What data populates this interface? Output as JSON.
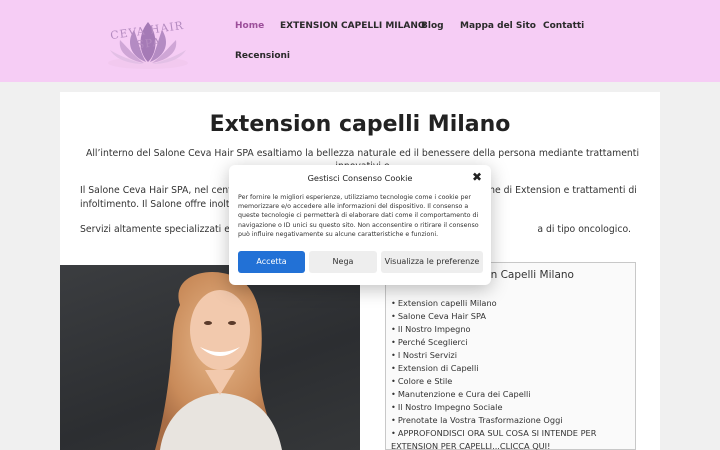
{
  "header": {
    "logo_text": "CEVA HAIR SPA",
    "nav": [
      {
        "label": "Home",
        "active": true
      },
      {
        "label": "EXTENSION CAPELLI MILANO"
      },
      {
        "label": "Blog"
      },
      {
        "label": "Mappa del Sito"
      },
      {
        "label": "Contatti"
      },
      {
        "label": "Recensioni"
      }
    ]
  },
  "main": {
    "title": "Extension capelli Milano",
    "intro": "All’interno del Salone Ceva Hair SPA esaltiamo la bellezza naturale ed il benessere della persona mediante trattamenti innovativi e",
    "p2_line1_left": "Il Salone Ceva Hair SPA, nel centro",
    "p2_line1_right": "ne di Extension e trattamenti di",
    "p2_line2": "infoltimento. Il Salone offre inoltre",
    "p3_left": "Servizi altamente specializzati e di",
    "p3_right": "a di tipo oncologico."
  },
  "toc": {
    "title": "Indice per Extension Capelli Milano",
    "items": [
      "Extension capelli Milano",
      "Salone Ceva Hair SPA",
      "Il Nostro Impegno",
      "Perché Sceglierci",
      "I Nostri Servizi",
      "Extension di Capelli",
      "Colore e Stile",
      "Manutenzione e Cura dei Capelli",
      "Il Nostro Impegno Sociale",
      "Prenotate la Vostra Trasformazione Oggi",
      "APPROFONDISCI ORA SUL COSA SI INTENDE PER EXTENSION PER CAPELLI...CLICCA QUI!"
    ]
  },
  "cookie_modal": {
    "title": "Gestisci Consenso Cookie",
    "text": "Per fornire le migliori esperienze, utilizziamo tecnologie come i cookie per memorizzare e/o accedere alle informazioni del dispositivo. Il consenso a queste tecnologie ci permetterà di elaborare dati come il comportamento di navigazione o ID unici su questo sito. Non acconsentire o ritirare il consenso può influire negativamente su alcune caratteristiche e funzioni.",
    "accept_label": "Accetta",
    "deny_label": "Nega",
    "prefs_label": "Visualizza le preferenze",
    "close_symbol": "✖"
  },
  "colors": {
    "header_bg": "#f6cdf5",
    "nav_active": "#9c4f9a",
    "accept_button": "#2271d6"
  }
}
